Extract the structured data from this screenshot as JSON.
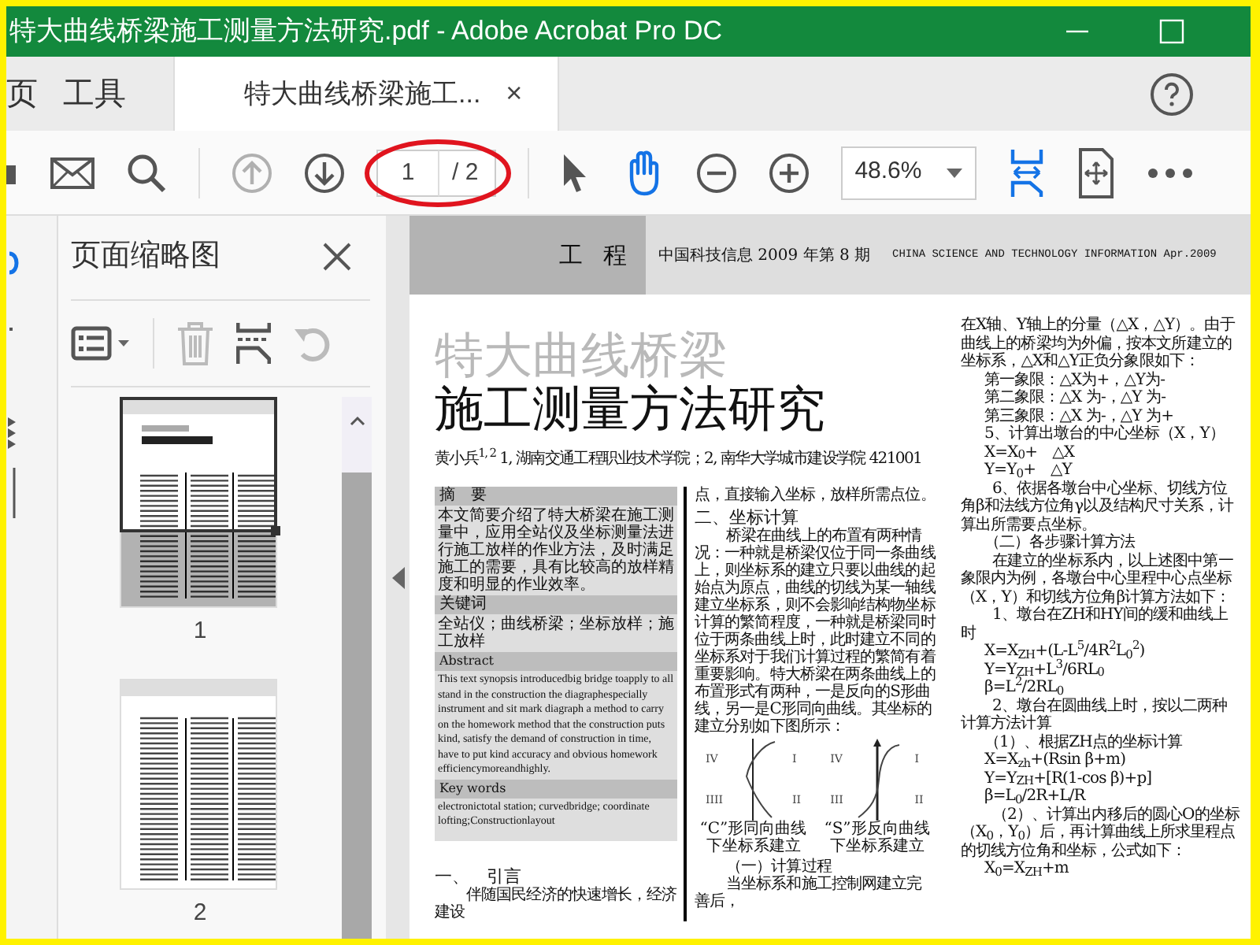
{
  "window": {
    "title": "特大曲线桥梁施工测量方法研究.pdf - Adobe Acrobat Pro DC"
  },
  "tabs": [
    {
      "label": "页",
      "selected": false
    },
    {
      "label": "工具",
      "selected": false
    },
    {
      "label": "特大曲线桥梁施工...",
      "selected": true,
      "close": "×"
    }
  ],
  "toolbar": {
    "prev_page": {
      "disabled": true
    },
    "next_page": {
      "disabled": false
    },
    "page_field": {
      "value": "1"
    },
    "page_total": "/ 2",
    "tools": [
      {
        "selected": false
      },
      {
        "selected": true
      }
    ],
    "zoom": {
      "value": "48.6%"
    },
    "view_modes": [
      {
        "selected": true
      },
      {
        "selected": false
      }
    ]
  },
  "thumbnails_panel": {
    "title": "页面缩略图",
    "thumbnails": [
      {
        "label": "1",
        "selected": true
      },
      {
        "label": "2",
        "selected": false
      }
    ]
  },
  "document": {
    "header": {
      "section": "工 程",
      "journal": "中国科技信息 2009 年第 8 期",
      "journal_en": "CHINA SCIENCE AND TECHNOLOGY INFORMATION Apr.2009"
    },
    "title_lines": [
      {
        "kind": "subtle",
        "text": "特大曲线桥梁"
      },
      {
        "kind": "main",
        "text": "施工测量方法研究"
      }
    ],
    "author": "黄小兵$^{1, 2}$ 1, 湖南交通工程职业技术学院；2, 南华大学城市建设学院 421001",
    "abstract": [
      {
        "kind": "heading",
        "text": "摘　要"
      },
      {
        "kind": "text",
        "text": "本文简要介绍了特大桥梁在施工测量中，应用全站仪及坐标测量法进行施工放样的作业方法，及时满足施工的需要，具有比较高的放样精度和明显的作业效率。"
      },
      {
        "kind": "heading",
        "text": "关键词"
      },
      {
        "kind": "text",
        "text": "全站仪；曲线桥梁；坐标放样；施工放样"
      },
      {
        "kind": "heading_en",
        "text": "Abstract"
      },
      {
        "kind": "text_en",
        "text": "This text synopsis introducedbig bridge toapply to all stand in the construction the diagraphespecially instrument and sit mark diagraph a method to carry on the homework method that the construction puts kind, satisfy the demand of construction in time, have to put kind accuracy and obvious homework efficiencymoreandhighly."
      },
      {
        "kind": "heading_en",
        "text": "Key words"
      },
      {
        "kind": "text_en",
        "text": "electronictotal station; curvedbridge; coordinate lofting;Constructionlayout"
      }
    ],
    "left_column": [
      {
        "kind": "section",
        "text": "一、　引言"
      },
      {
        "kind": "para",
        "text": "伴随国民经济的快速增长，经济建设"
      }
    ],
    "middle_column": [
      {
        "kind": "cont",
        "text": "点，直接输入坐标，放样所需点位。"
      },
      {
        "kind": "section",
        "text": "二、坐标计算"
      },
      {
        "kind": "para",
        "text": "桥梁在曲线上的布置有两种情况：一种就是桥梁仅位于同一条曲线上，则坐标系的建立只要以曲线的起始点为原点，曲线的切线为某一轴线建立坐标系，则不会影响结构物坐标计算的繁简程度，一种就是桥梁同时位于两条曲线上时，此时建立不同的坐标系对于我们计算过程的繁简有着重要影响。特大桥梁在两条曲线上的布置形式有两种，一是反向的S形曲线，另一是C形同向曲线。其坐标的建立分别如下图所示："
      },
      {
        "kind": "figures",
        "figures": [
          {
            "kind": "c_curve",
            "quadrants": [
              "IV",
              "I",
              "IIII",
              "II"
            ],
            "caption": [
              "“C”形同向曲线",
              "下坐标系建立"
            ]
          },
          {
            "kind": "s_curve",
            "quadrants": [
              "IV",
              "I",
              "III",
              "II"
            ],
            "caption": [
              "“S”形反向曲线",
              "下坐标系建立"
            ]
          }
        ]
      },
      {
        "kind": "subhead",
        "text": "（一）计算过程"
      },
      {
        "kind": "para",
        "text": "当坐标系和施工控制网建立完善后，"
      }
    ],
    "right_column": [
      {
        "kind": "cont",
        "text": "在X轴、Y轴上的分量（△X，△Y）。由于曲线上的桥梁均为外偏，按本文所建立的坐标系，△X和△Y正负分象限如下："
      },
      {
        "kind": "line",
        "text": "第一象限：△X为+，△Y为-"
      },
      {
        "kind": "line",
        "text": "第二象限：△X 为-，△Y 为-"
      },
      {
        "kind": "line",
        "text": "第三象限：△X 为-，△Y 为+"
      },
      {
        "kind": "line",
        "text": "5、计算出墩台的中心坐标（X，Y）"
      },
      {
        "kind": "line",
        "text": "X=X$_{0}$+　△X"
      },
      {
        "kind": "line",
        "text": "Y=Y$_{0}$+　△Y"
      },
      {
        "kind": "para",
        "text": "6、依据各墩台中心坐标、切线方位角β和法线方位角γ以及结构尺寸关系，计算出所需要点坐标。"
      },
      {
        "kind": "line",
        "text": "（二）各步骤计算方法"
      },
      {
        "kind": "para",
        "text": "在建立的坐标系内，以上述图中第一象限内为例，各墩台中心里程中心点坐标（X，Y）和切线方位角β计算方法如下："
      },
      {
        "kind": "para",
        "text": "1、墩台在ZH和HY间的缓和曲线上时"
      },
      {
        "kind": "line",
        "text": "X=X$_{ZH}$+(L-L$^{5}$/4R$^{2}$L$_{0}$$^{2}$)"
      },
      {
        "kind": "line",
        "text": "Y=Y$_{ZH}$+L$^{3}$/6RL$_{0}$"
      },
      {
        "kind": "line",
        "text": "β=L$^{2}$/2RL$_{0}$"
      },
      {
        "kind": "para",
        "text": "2、墩台在圆曲线上时，按以二两种计算方法计算"
      },
      {
        "kind": "line",
        "text": "（1）、根据ZH点的坐标计算"
      },
      {
        "kind": "line",
        "text": "X=X$_{zh}$+(Rsin β+m)"
      },
      {
        "kind": "line",
        "text": "Y=Y$_{ZH}$+[R(1-cos β)+p]"
      },
      {
        "kind": "line",
        "text": "β=L$_{0}$/2R+L/R"
      },
      {
        "kind": "para",
        "text": "（2）、计算出内移后的圆心O的坐标（X$_{0}$，Y$_{0}$）后，再计算曲线上所求里程点的切线方位角和坐标，公式如下："
      },
      {
        "kind": "line",
        "text": "X$_{0}$=X$_{ZH}$+m"
      }
    ]
  }
}
